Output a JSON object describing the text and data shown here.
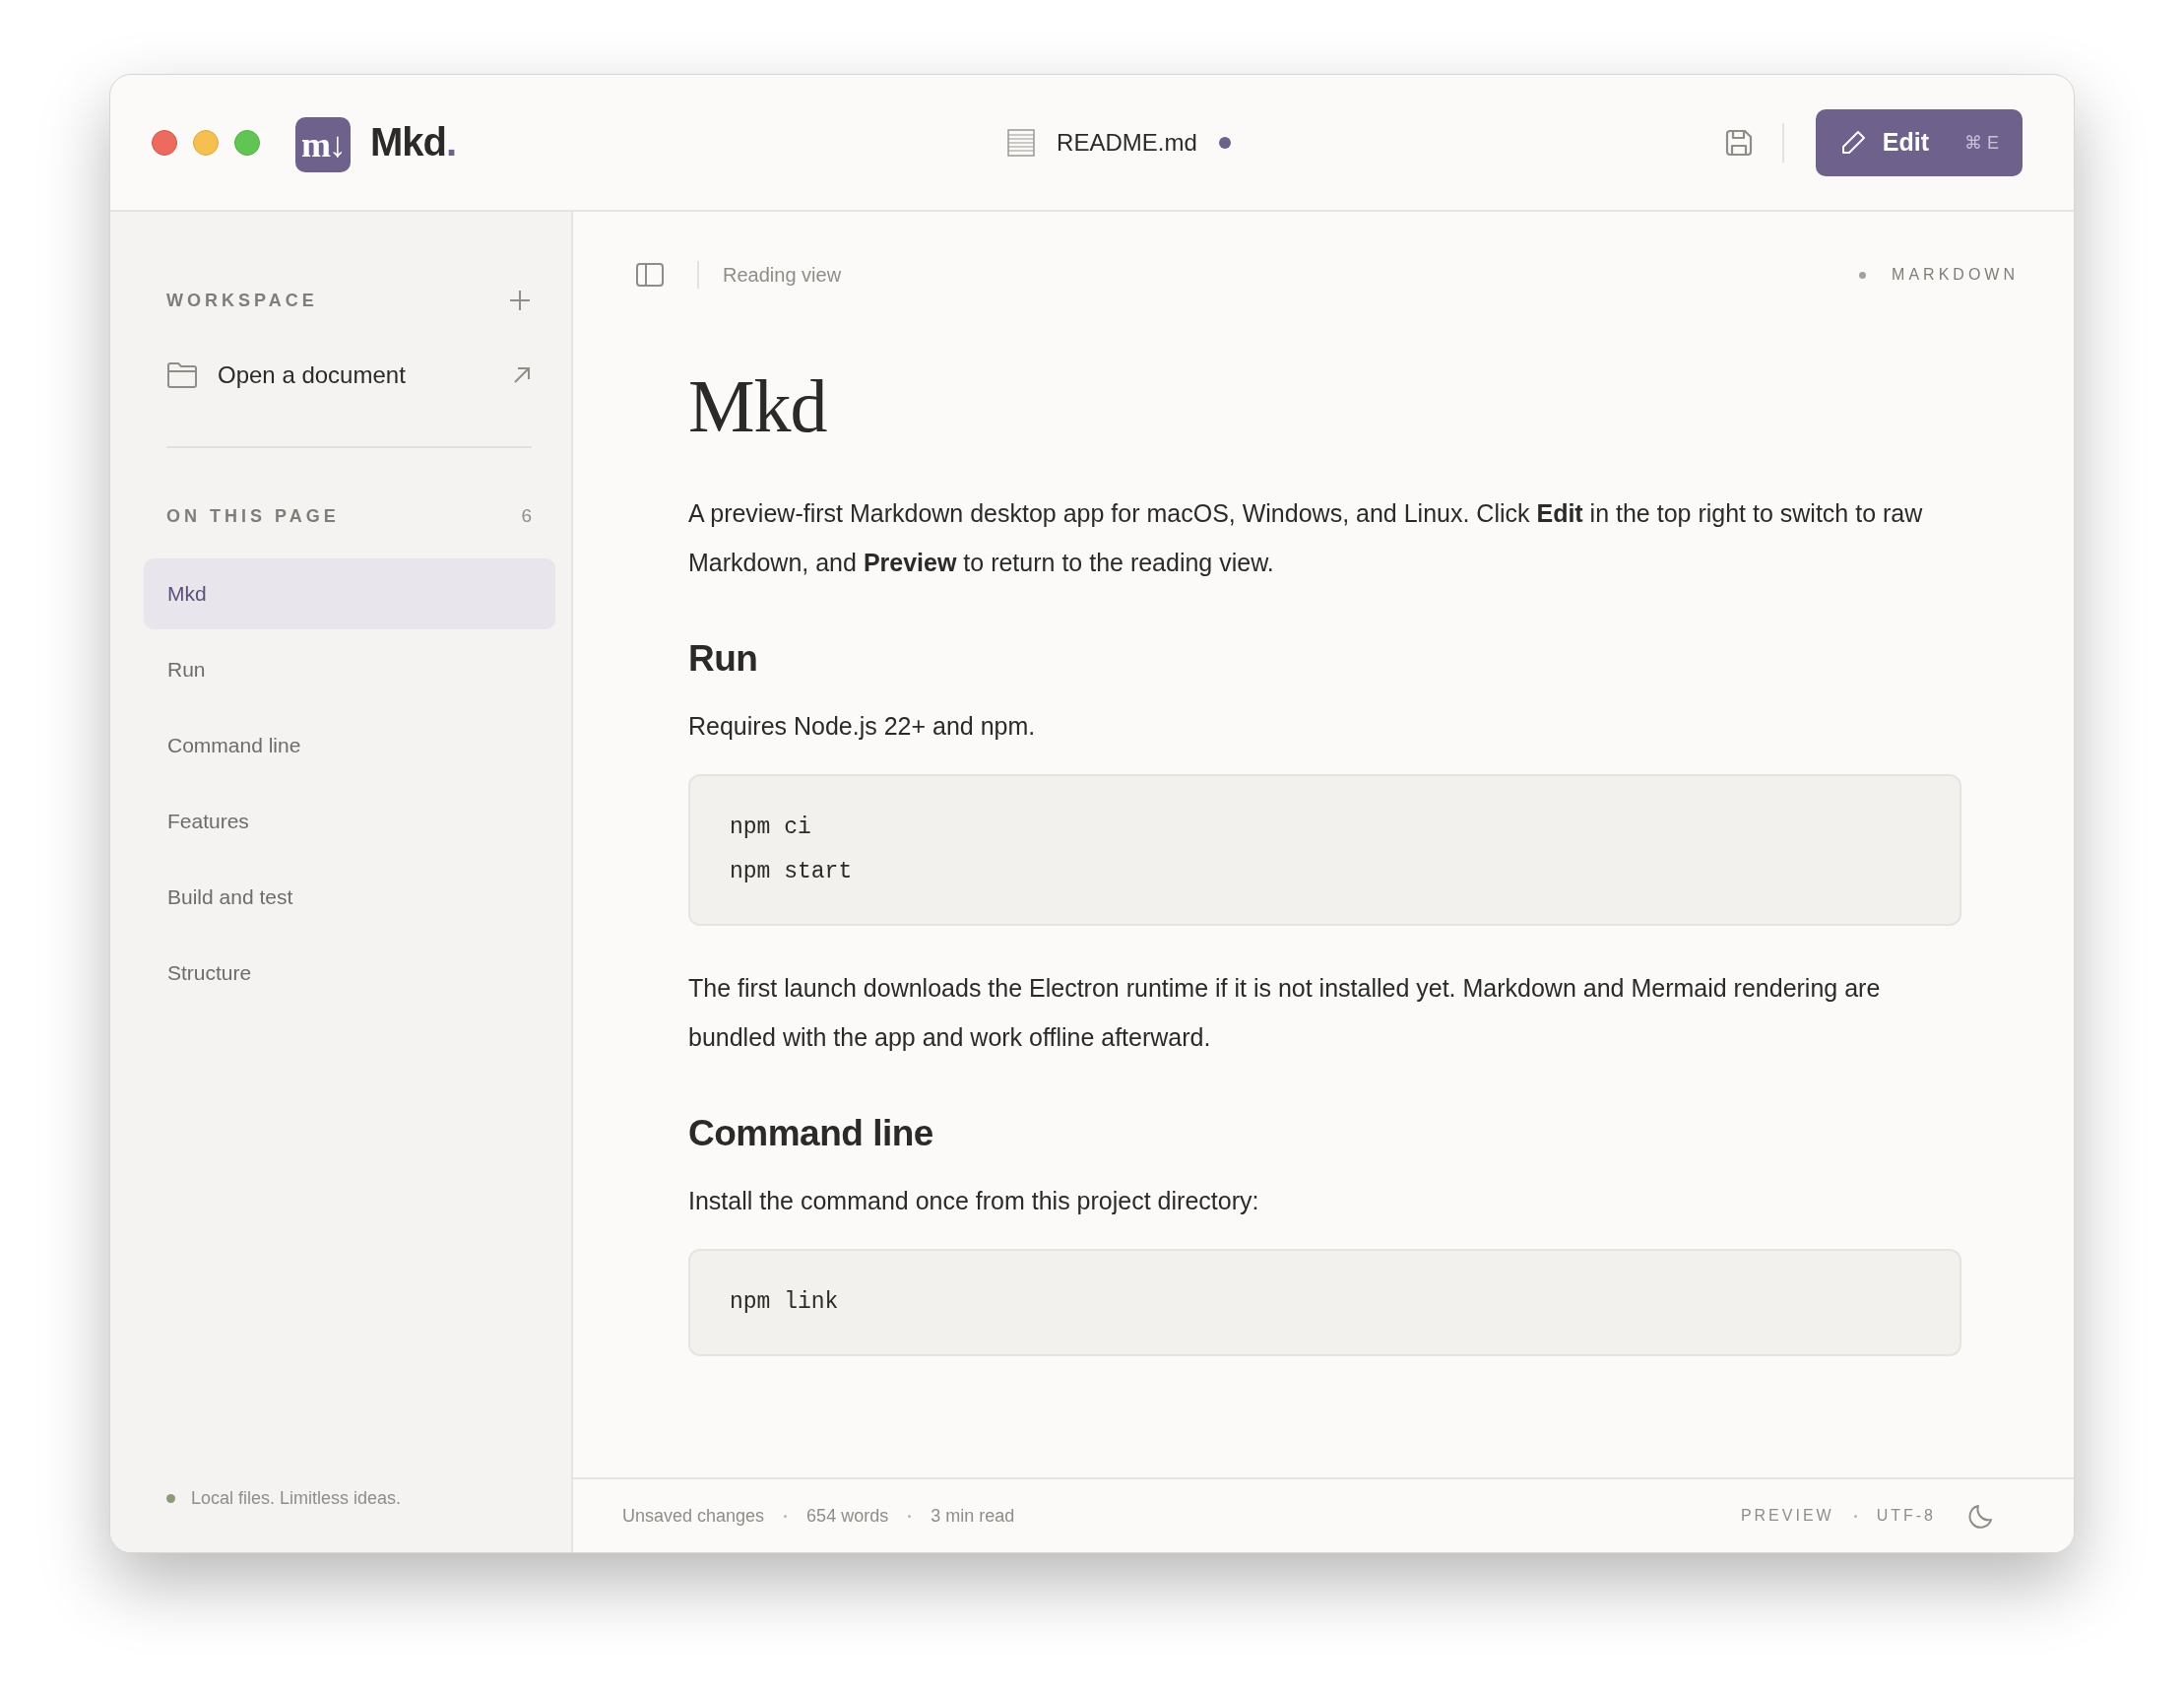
{
  "app": {
    "logo_mark": "m↓",
    "name": "Mkd",
    "name_suffix": "."
  },
  "document": {
    "filename": "README.md",
    "unsaved": true
  },
  "edit_button": {
    "label": "Edit",
    "shortcut": "⌘ E"
  },
  "sidebar": {
    "workspace_label": "WORKSPACE",
    "open_document": "Open a document",
    "toc_label": "ON THIS PAGE",
    "toc_count": "6",
    "toc": [
      {
        "label": "Mkd",
        "selected": true
      },
      {
        "label": "Run",
        "selected": false
      },
      {
        "label": "Command line",
        "selected": false
      },
      {
        "label": "Features",
        "selected": false
      },
      {
        "label": "Build and test",
        "selected": false
      },
      {
        "label": "Structure",
        "selected": false
      }
    ],
    "tagline": "Local files. Limitless ideas."
  },
  "view_bar": {
    "mode": "Reading view",
    "format": "MARKDOWN"
  },
  "content": [
    {
      "kind": "h1",
      "text": "Mkd"
    },
    {
      "kind": "p",
      "text": "A preview-first Markdown desktop app for macOS, Windows, and Linux. Click **Edit** in the top right to switch to raw Markdown, and **Preview** to return to the reading view."
    },
    {
      "kind": "h2",
      "text": "Run"
    },
    {
      "kind": "p",
      "text": "Requires Node.js 22+ and npm."
    },
    {
      "kind": "code",
      "lines": [
        "npm ci",
        "npm start"
      ]
    },
    {
      "kind": "p",
      "text": "The first launch downloads the Electron runtime if it is not installed yet. Markdown and Mermaid rendering are bundled with the app and work offline afterward."
    },
    {
      "kind": "h2",
      "text": "Command line"
    },
    {
      "kind": "p",
      "text": "Install the command once from this project directory:"
    },
    {
      "kind": "code",
      "lines": [
        "npm link"
      ]
    }
  ],
  "status_bar": {
    "left": [
      "Unsaved changes",
      "654 words",
      "3 min read"
    ],
    "right": [
      "PREVIEW",
      "UTF-8"
    ]
  }
}
